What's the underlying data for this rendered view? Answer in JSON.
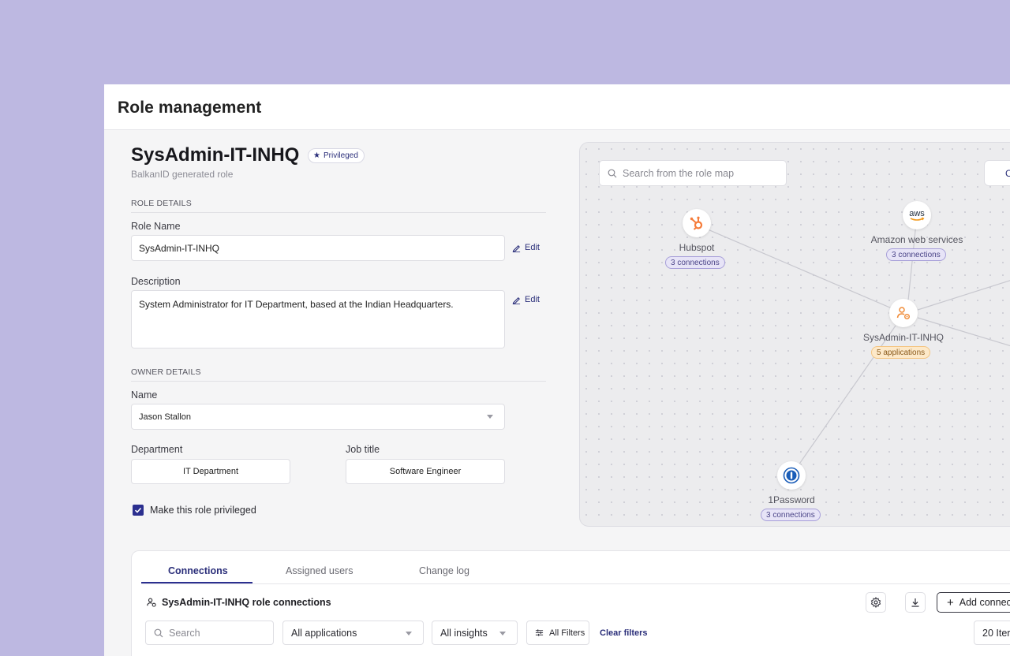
{
  "header": {
    "title": "Role management"
  },
  "role": {
    "name": "SysAdmin-IT-INHQ",
    "badge": "Privileged",
    "subtitle": "BalkanID generated role"
  },
  "role_details": {
    "section": "ROLE DETAILS",
    "name_label": "Role Name",
    "name_value": "SysAdmin-IT-INHQ",
    "description_label": "Description",
    "description_value": "System Administrator for IT Department, based at the Indian Headquarters.",
    "edit_label": "Edit"
  },
  "owner_details": {
    "section": "OWNER DETAILS",
    "name_label": "Name",
    "name_value": "Jason Stallon",
    "department_label": "Department",
    "department_value": "IT Department",
    "job_title_label": "Job title",
    "job_title_value": "Software Engineer"
  },
  "privileged_checkbox": {
    "label": "Make this role privileged",
    "checked": true
  },
  "role_map": {
    "search_placeholder": "Search from the role map",
    "button_initial": "C",
    "nodes": {
      "hubspot": {
        "label": "Hubspot",
        "count": "3 connections",
        "icon": "hubspot-icon",
        "color": "#f57c3a"
      },
      "aws": {
        "label": "Amazon web services",
        "count": "3 connections",
        "icon": "aws-icon",
        "logo_text": "aws"
      },
      "role": {
        "label": "SysAdmin-IT-INHQ",
        "count": "5 applications",
        "icon": "role-user-icon",
        "color": "#f08a35"
      },
      "onepassword": {
        "label": "1Password",
        "count": "3 connections",
        "icon": "onepassword-icon",
        "color": "#1a5db8"
      }
    }
  },
  "tabs": [
    {
      "label": "Connections",
      "active": true
    },
    {
      "label": "Assigned users",
      "active": false
    },
    {
      "label": "Change log",
      "active": false
    }
  ],
  "connections": {
    "title": "SysAdmin-IT-INHQ role connections",
    "add_button": "Add connec",
    "search_placeholder": "Search",
    "applications_filter": "All applications",
    "insights_filter": "All insights",
    "all_filters": "All Filters",
    "clear_filters": "Clear filters",
    "items_per_page": "20 Iter"
  },
  "colors": {
    "accent": "#2b2f8f",
    "background": "#bdb8e1"
  }
}
